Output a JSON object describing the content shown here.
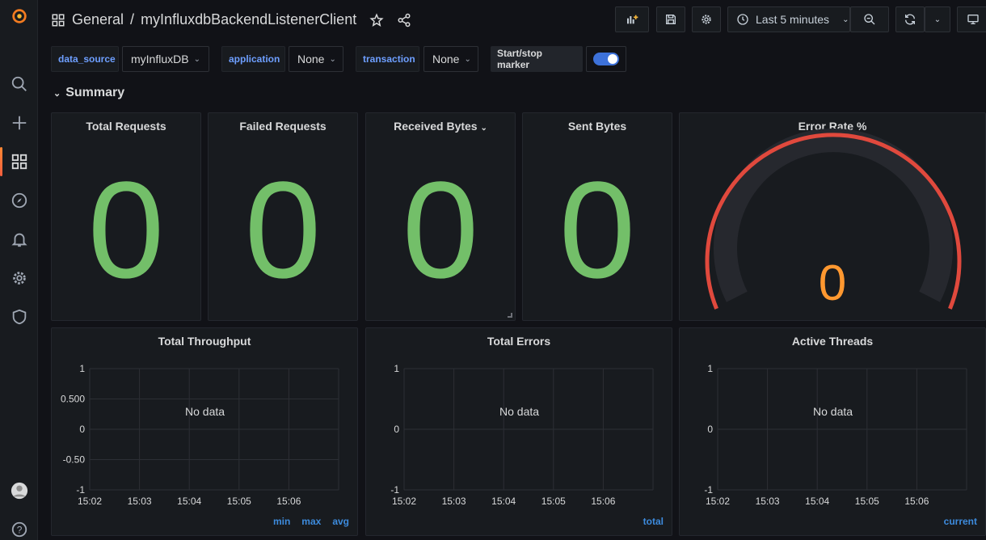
{
  "breadcrumb": {
    "folder": "General",
    "separator": "/",
    "dashboard": "myInfluxdbBackendListenerClient"
  },
  "toolbar": {
    "time_range": "Last 5 minutes"
  },
  "variables": [
    {
      "label": "data_source",
      "value": "myInfluxDB"
    },
    {
      "label": "application",
      "value": "None"
    },
    {
      "label": "transaction",
      "value": "None"
    }
  ],
  "marker": {
    "label": "Start/stop marker",
    "enabled": true
  },
  "row": {
    "title": "Summary"
  },
  "stats": [
    {
      "title": "Total Requests",
      "value": "0"
    },
    {
      "title": "Failed Requests",
      "value": "0"
    },
    {
      "title": "Received Bytes",
      "value": "0"
    },
    {
      "title": "Sent Bytes",
      "value": "0"
    }
  ],
  "gauge": {
    "title": "Error Rate %",
    "value": "0",
    "fraction": 0
  },
  "graphs": [
    {
      "title": "Total Throughput",
      "no_data": "No data",
      "y_ticks": [
        "1",
        "0.500",
        "0",
        "-0.50",
        "-1"
      ],
      "x_ticks": [
        "15:02",
        "15:03",
        "15:04",
        "15:05",
        "15:06"
      ],
      "legend": [
        "min",
        "max",
        "avg"
      ]
    },
    {
      "title": "Total Errors",
      "no_data": "No data",
      "y_ticks": [
        "1",
        "0",
        "-1"
      ],
      "x_ticks": [
        "15:02",
        "15:03",
        "15:04",
        "15:05",
        "15:06"
      ],
      "legend": [
        "total"
      ]
    },
    {
      "title": "Active Threads",
      "no_data": "No data",
      "y_ticks": [
        "1",
        "0",
        "-1"
      ],
      "x_ticks": [
        "15:02",
        "15:03",
        "15:04",
        "15:05",
        "15:06"
      ],
      "legend": [
        "current"
      ]
    }
  ],
  "colors": {
    "stat_green": "#73bf69",
    "gauge_red": "#e0493d",
    "gauge_value": "#ff9830",
    "accent_blue": "#3d71d9",
    "legend_blue": "#3d8bdd"
  },
  "icons": {
    "sidebar": [
      "grafana-logo-icon",
      "search-icon",
      "plus-icon",
      "dashboards-icon",
      "explore-icon",
      "alerting-icon",
      "settings-icon",
      "shield-icon",
      "avatar",
      "help-icon"
    ],
    "topbar": [
      "dashboard-grid-icon",
      "star-icon",
      "share-icon",
      "add-panel-icon",
      "save-icon",
      "settings-icon",
      "clock-icon",
      "zoom-out-icon",
      "refresh-icon",
      "tv-mode-icon"
    ]
  }
}
